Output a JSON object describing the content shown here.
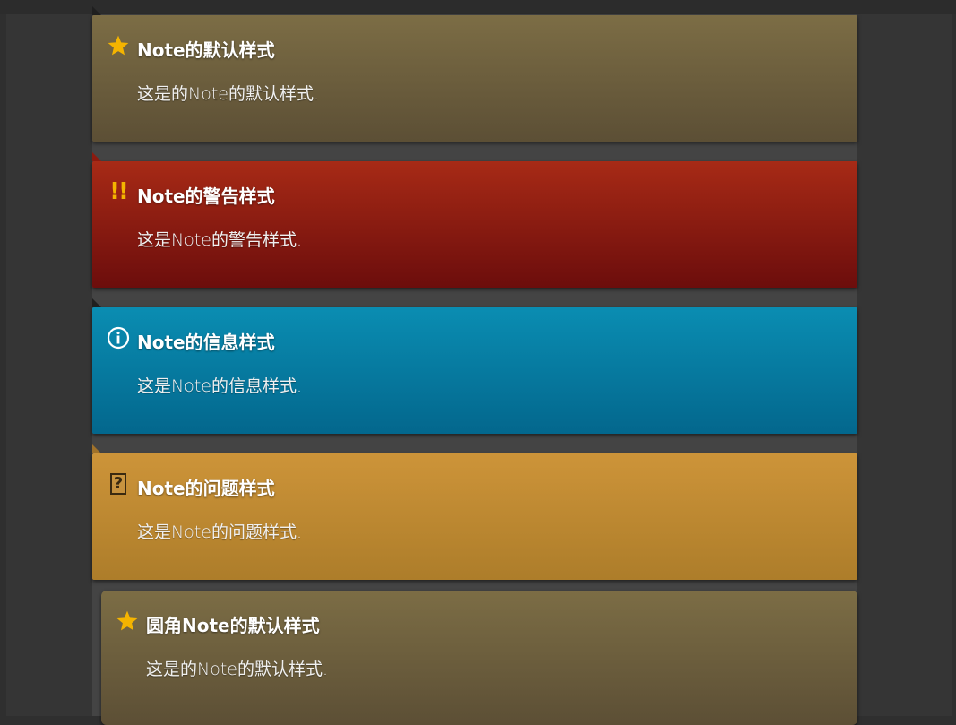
{
  "notes": [
    {
      "title": "Note的默认样式",
      "body": "这是的Note的默认样式.",
      "icon": "star-icon",
      "style": "default",
      "color": "#7c6d45"
    },
    {
      "title": "Note的警告样式",
      "body": "这是Note的警告样式.",
      "icon": "double-exclamation-icon",
      "style": "warning",
      "color": "#a72a16"
    },
    {
      "title": "Note的信息样式",
      "body": "这是Note的信息样式.",
      "icon": "info-icon",
      "style": "info",
      "color": "#0a8db2"
    },
    {
      "title": "Note的问题样式",
      "body": "这是Note的问题样式.",
      "icon": "question-icon",
      "style": "question",
      "color": "#cd9439"
    },
    {
      "title": "圆角Note的默认样式",
      "body": "这是的Note的默认样式.",
      "icon": "star-icon",
      "style": "default-rounded",
      "color": "#7c6d45"
    }
  ],
  "accent": {
    "star": "#f4b400",
    "background": "#2f2f2f"
  }
}
